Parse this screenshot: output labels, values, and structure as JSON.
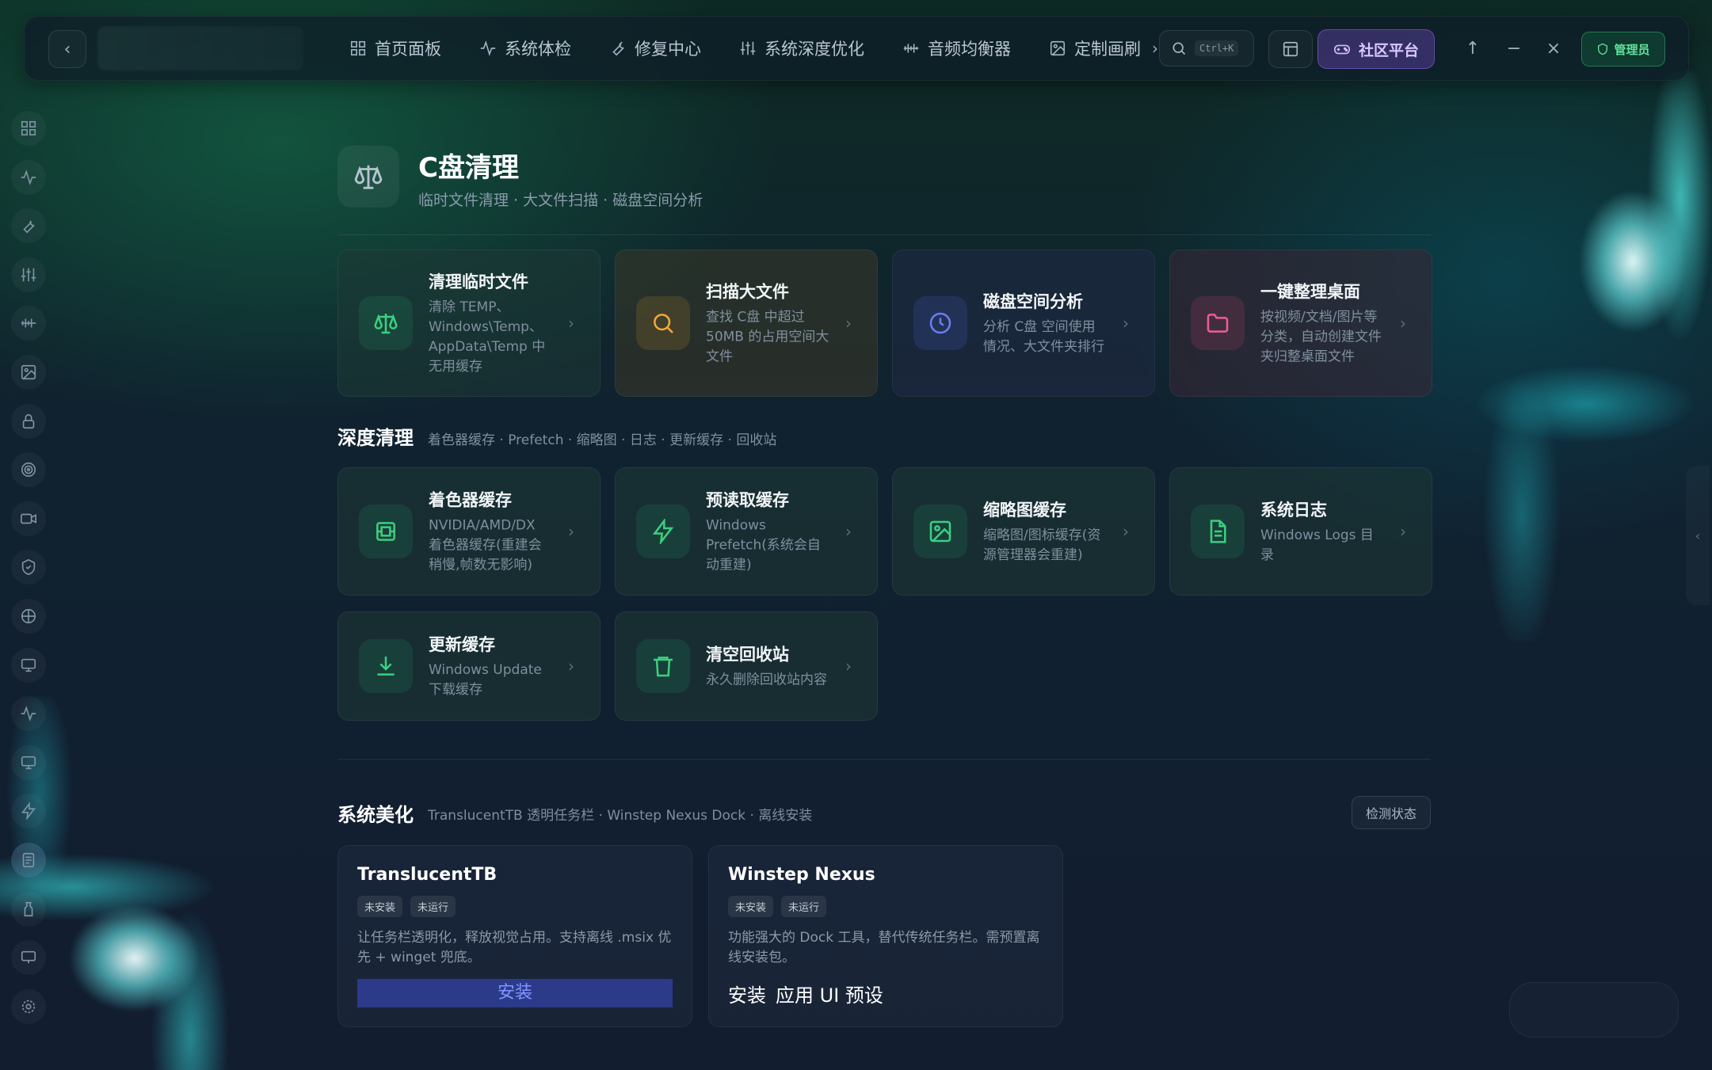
{
  "topbar": {
    "nav": [
      {
        "label": "首页面板",
        "icon": "grid-icon"
      },
      {
        "label": "系统体检",
        "icon": "pulse-icon"
      },
      {
        "label": "修复中心",
        "icon": "wrench-icon"
      },
      {
        "label": "系统深度优化",
        "icon": "sliders-icon"
      },
      {
        "label": "音频均衡器",
        "icon": "waveform-icon"
      },
      {
        "label": "定制画刷",
        "icon": "image-icon"
      }
    ],
    "search_shortcut": "Ctrl+K",
    "community": "社区平台",
    "admin": "管理员"
  },
  "page": {
    "title": "C盘清理",
    "subtitle": "临时文件清理 · 大文件扫描 · 磁盘空间分析"
  },
  "quick_cards": [
    {
      "title": "清理临时文件",
      "desc": "清除 TEMP、Windows\\Temp、AppData\\Temp 中无用缓存",
      "icon": "scale-icon"
    },
    {
      "title": "扫描大文件",
      "desc": "查找 C盘 中超过 50MB 的占用空间大文件",
      "icon": "search-icon"
    },
    {
      "title": "磁盘空间分析",
      "desc": "分析 C盘 空间使用情况、大文件夹排行",
      "icon": "clock-icon"
    },
    {
      "title": "一键整理桌面",
      "desc": "按视频/文档/图片等分类，自动创建文件夹归整桌面文件",
      "icon": "folder-icon"
    }
  ],
  "deep": {
    "title": "深度清理",
    "subtitle": "着色器缓存 · Prefetch · 缩略图 · 日志 · 更新缓存 · 回收站",
    "cards": [
      {
        "title": "着色器缓存",
        "desc": "NVIDIA/AMD/DX 着色器缓存(重建会稍慢,帧数无影响)",
        "icon": "chip-icon"
      },
      {
        "title": "预读取缓存",
        "desc": "Windows Prefetch(系统会自动重建)",
        "icon": "lightning-icon"
      },
      {
        "title": "缩略图缓存",
        "desc": "缩略图/图标缓存(资源管理器会重建)",
        "icon": "image-icon"
      },
      {
        "title": "系统日志",
        "desc": "Windows Logs 目录",
        "icon": "file-text-icon"
      },
      {
        "title": "更新缓存",
        "desc": "Windows Update 下载缓存",
        "icon": "download-icon"
      },
      {
        "title": "清空回收站",
        "desc": "永久删除回收站内容",
        "icon": "trash-icon"
      }
    ]
  },
  "beauty": {
    "title": "系统美化",
    "subtitle": "TranslucentTB 透明任务栏 · Winstep Nexus Dock · 离线安装",
    "check_button": "检测状态",
    "apps": [
      {
        "name": "TranslucentTB",
        "tag1": "未安装",
        "tag2": "未运行",
        "desc": "让任务栏透明化，释放视觉占用。支持离线 .msix 优先 + winget 兜底。",
        "install": "安装"
      },
      {
        "name": "Winstep Nexus",
        "tag1": "未安装",
        "tag2": "未运行",
        "desc": "功能强大的 Dock 工具，替代传统任务栏。需预置离线安装包。",
        "install": "安装",
        "apply": "应用 UI 预设"
      }
    ]
  }
}
